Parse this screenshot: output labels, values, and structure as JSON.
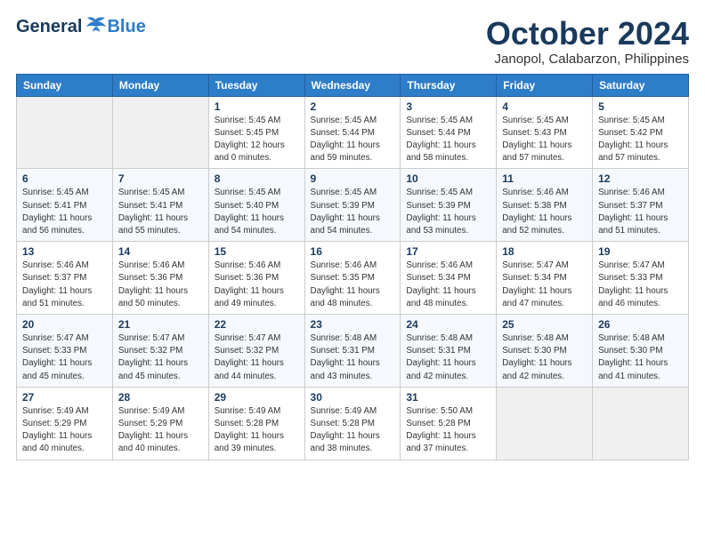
{
  "header": {
    "logo_general": "General",
    "logo_blue": "Blue",
    "month_title": "October 2024",
    "location": "Janopol, Calabarzon, Philippines"
  },
  "columns": [
    "Sunday",
    "Monday",
    "Tuesday",
    "Wednesday",
    "Thursday",
    "Friday",
    "Saturday"
  ],
  "weeks": [
    [
      {
        "day": "",
        "sunrise": "",
        "sunset": "",
        "daylight": ""
      },
      {
        "day": "",
        "sunrise": "",
        "sunset": "",
        "daylight": ""
      },
      {
        "day": "1",
        "sunrise": "Sunrise: 5:45 AM",
        "sunset": "Sunset: 5:45 PM",
        "daylight": "Daylight: 12 hours and 0 minutes."
      },
      {
        "day": "2",
        "sunrise": "Sunrise: 5:45 AM",
        "sunset": "Sunset: 5:44 PM",
        "daylight": "Daylight: 11 hours and 59 minutes."
      },
      {
        "day": "3",
        "sunrise": "Sunrise: 5:45 AM",
        "sunset": "Sunset: 5:44 PM",
        "daylight": "Daylight: 11 hours and 58 minutes."
      },
      {
        "day": "4",
        "sunrise": "Sunrise: 5:45 AM",
        "sunset": "Sunset: 5:43 PM",
        "daylight": "Daylight: 11 hours and 57 minutes."
      },
      {
        "day": "5",
        "sunrise": "Sunrise: 5:45 AM",
        "sunset": "Sunset: 5:42 PM",
        "daylight": "Daylight: 11 hours and 57 minutes."
      }
    ],
    [
      {
        "day": "6",
        "sunrise": "Sunrise: 5:45 AM",
        "sunset": "Sunset: 5:41 PM",
        "daylight": "Daylight: 11 hours and 56 minutes."
      },
      {
        "day": "7",
        "sunrise": "Sunrise: 5:45 AM",
        "sunset": "Sunset: 5:41 PM",
        "daylight": "Daylight: 11 hours and 55 minutes."
      },
      {
        "day": "8",
        "sunrise": "Sunrise: 5:45 AM",
        "sunset": "Sunset: 5:40 PM",
        "daylight": "Daylight: 11 hours and 54 minutes."
      },
      {
        "day": "9",
        "sunrise": "Sunrise: 5:45 AM",
        "sunset": "Sunset: 5:39 PM",
        "daylight": "Daylight: 11 hours and 54 minutes."
      },
      {
        "day": "10",
        "sunrise": "Sunrise: 5:45 AM",
        "sunset": "Sunset: 5:39 PM",
        "daylight": "Daylight: 11 hours and 53 minutes."
      },
      {
        "day": "11",
        "sunrise": "Sunrise: 5:46 AM",
        "sunset": "Sunset: 5:38 PM",
        "daylight": "Daylight: 11 hours and 52 minutes."
      },
      {
        "day": "12",
        "sunrise": "Sunrise: 5:46 AM",
        "sunset": "Sunset: 5:37 PM",
        "daylight": "Daylight: 11 hours and 51 minutes."
      }
    ],
    [
      {
        "day": "13",
        "sunrise": "Sunrise: 5:46 AM",
        "sunset": "Sunset: 5:37 PM",
        "daylight": "Daylight: 11 hours and 51 minutes."
      },
      {
        "day": "14",
        "sunrise": "Sunrise: 5:46 AM",
        "sunset": "Sunset: 5:36 PM",
        "daylight": "Daylight: 11 hours and 50 minutes."
      },
      {
        "day": "15",
        "sunrise": "Sunrise: 5:46 AM",
        "sunset": "Sunset: 5:36 PM",
        "daylight": "Daylight: 11 hours and 49 minutes."
      },
      {
        "day": "16",
        "sunrise": "Sunrise: 5:46 AM",
        "sunset": "Sunset: 5:35 PM",
        "daylight": "Daylight: 11 hours and 48 minutes."
      },
      {
        "day": "17",
        "sunrise": "Sunrise: 5:46 AM",
        "sunset": "Sunset: 5:34 PM",
        "daylight": "Daylight: 11 hours and 48 minutes."
      },
      {
        "day": "18",
        "sunrise": "Sunrise: 5:47 AM",
        "sunset": "Sunset: 5:34 PM",
        "daylight": "Daylight: 11 hours and 47 minutes."
      },
      {
        "day": "19",
        "sunrise": "Sunrise: 5:47 AM",
        "sunset": "Sunset: 5:33 PM",
        "daylight": "Daylight: 11 hours and 46 minutes."
      }
    ],
    [
      {
        "day": "20",
        "sunrise": "Sunrise: 5:47 AM",
        "sunset": "Sunset: 5:33 PM",
        "daylight": "Daylight: 11 hours and 45 minutes."
      },
      {
        "day": "21",
        "sunrise": "Sunrise: 5:47 AM",
        "sunset": "Sunset: 5:32 PM",
        "daylight": "Daylight: 11 hours and 45 minutes."
      },
      {
        "day": "22",
        "sunrise": "Sunrise: 5:47 AM",
        "sunset": "Sunset: 5:32 PM",
        "daylight": "Daylight: 11 hours and 44 minutes."
      },
      {
        "day": "23",
        "sunrise": "Sunrise: 5:48 AM",
        "sunset": "Sunset: 5:31 PM",
        "daylight": "Daylight: 11 hours and 43 minutes."
      },
      {
        "day": "24",
        "sunrise": "Sunrise: 5:48 AM",
        "sunset": "Sunset: 5:31 PM",
        "daylight": "Daylight: 11 hours and 42 minutes."
      },
      {
        "day": "25",
        "sunrise": "Sunrise: 5:48 AM",
        "sunset": "Sunset: 5:30 PM",
        "daylight": "Daylight: 11 hours and 42 minutes."
      },
      {
        "day": "26",
        "sunrise": "Sunrise: 5:48 AM",
        "sunset": "Sunset: 5:30 PM",
        "daylight": "Daylight: 11 hours and 41 minutes."
      }
    ],
    [
      {
        "day": "27",
        "sunrise": "Sunrise: 5:49 AM",
        "sunset": "Sunset: 5:29 PM",
        "daylight": "Daylight: 11 hours and 40 minutes."
      },
      {
        "day": "28",
        "sunrise": "Sunrise: 5:49 AM",
        "sunset": "Sunset: 5:29 PM",
        "daylight": "Daylight: 11 hours and 40 minutes."
      },
      {
        "day": "29",
        "sunrise": "Sunrise: 5:49 AM",
        "sunset": "Sunset: 5:28 PM",
        "daylight": "Daylight: 11 hours and 39 minutes."
      },
      {
        "day": "30",
        "sunrise": "Sunrise: 5:49 AM",
        "sunset": "Sunset: 5:28 PM",
        "daylight": "Daylight: 11 hours and 38 minutes."
      },
      {
        "day": "31",
        "sunrise": "Sunrise: 5:50 AM",
        "sunset": "Sunset: 5:28 PM",
        "daylight": "Daylight: 11 hours and 37 minutes."
      },
      {
        "day": "",
        "sunrise": "",
        "sunset": "",
        "daylight": ""
      },
      {
        "day": "",
        "sunrise": "",
        "sunset": "",
        "daylight": ""
      }
    ]
  ]
}
